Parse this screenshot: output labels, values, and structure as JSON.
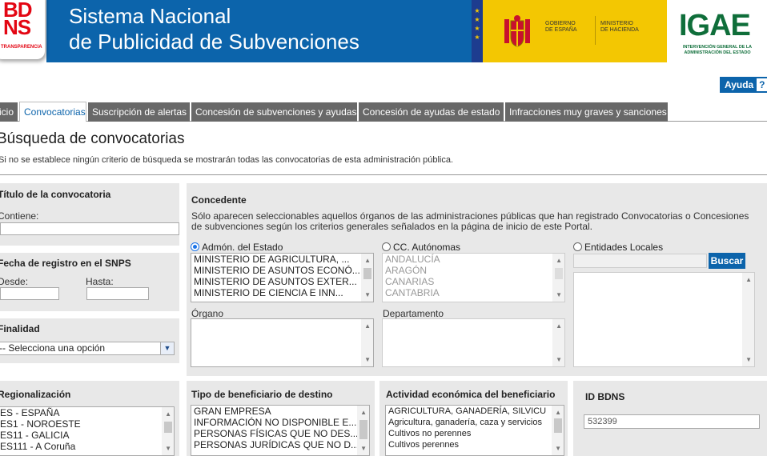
{
  "header": {
    "logo_letters": "BD\nNS",
    "logo_subtitle": "TRANSPARENCIA",
    "title": "Sistema Nacional\nde Publicidad de Subvenciones",
    "gov_text": "GOBIERNO\nDE ESPAÑA",
    "ministry_text": "MINISTERIO\nDE HACIENDA",
    "igae_logo": "IGAE",
    "igae_subtitle": "INTERVENCIÓN GENERAL DE LA ADMINISTRACIÓN DEL ESTADO",
    "help_label": "Ayuda",
    "help_icon": "?"
  },
  "tabs": [
    {
      "label": "Inicio"
    },
    {
      "label": "Convocatorias"
    },
    {
      "label": "Suscripción de alertas"
    },
    {
      "label": "Concesión de subvenciones y ayudas"
    },
    {
      "label": "Concesión de ayudas de estado"
    },
    {
      "label": "Infracciones muy graves y sanciones"
    }
  ],
  "page": {
    "title": "Búsqueda de convocatorias",
    "intro": "Si no se establece ningún criterio de búsqueda se mostrarán todas las convocatorias de esta administración pública."
  },
  "titulo": {
    "heading": "Título de la convocatoria",
    "contains_label": "Contiene:",
    "value": ""
  },
  "fecha": {
    "heading": "Fecha de registro en el SNPS",
    "from_label": "Desde:",
    "to_label": "Hasta:"
  },
  "finalidad": {
    "heading": "Finalidad",
    "selected": "-- Selecciona una opción"
  },
  "regionalizacion": {
    "heading": "Regionalización",
    "options": [
      "ES - ESPAÑA",
      "ES1 - NOROESTE",
      "ES11 - GALICIA",
      "ES111 - A Coruña"
    ]
  },
  "concedente": {
    "heading": "Concedente",
    "description": "Sólo aparecen seleccionables aquellos órganos de las administraciones públicas que han registrado Convocatorias o Concesiones de subvenciones según los criterios generales señalados en la página de inicio de este Portal.",
    "radio_estado": "Admón. del Estado",
    "radio_ccaa": "CC. Autónomas",
    "radio_locales": "Entidades Locales",
    "estado_options": [
      "MINISTERIO DE AGRICULTURA, ...",
      "MINISTERIO DE ASUNTOS ECONÓ...",
      "MINISTERIO DE ASUNTOS EXTER...",
      "MINISTERIO DE CIENCIA E INN..."
    ],
    "ccaa_options": [
      "ANDALUCÍA",
      "ARAGÓN",
      "CANARIAS",
      "CANTABRIA"
    ],
    "search_button": "Buscar",
    "organo_label": "Órgano",
    "departamento_label": "Departamento"
  },
  "tipo_beneficiario": {
    "heading": "Tipo de beneficiario de destino",
    "options": [
      "GRAN EMPRESA",
      "INFORMACIÓN NO DISPONIBLE E...",
      "PERSONAS FÍSICAS QUE NO DES...",
      "PERSONAS JURÍDICAS QUE NO D..."
    ]
  },
  "actividad": {
    "heading": "Actividad económica del beneficiario",
    "options": [
      "AGRICULTURA, GANADERÍA, SILVICU",
      "Agricultura, ganadería, caza y servicios",
      "Cultivos no perennes",
      "Cultivos perennes"
    ]
  },
  "id_bdns": {
    "heading": "ID BDNS",
    "value": "532399"
  }
}
